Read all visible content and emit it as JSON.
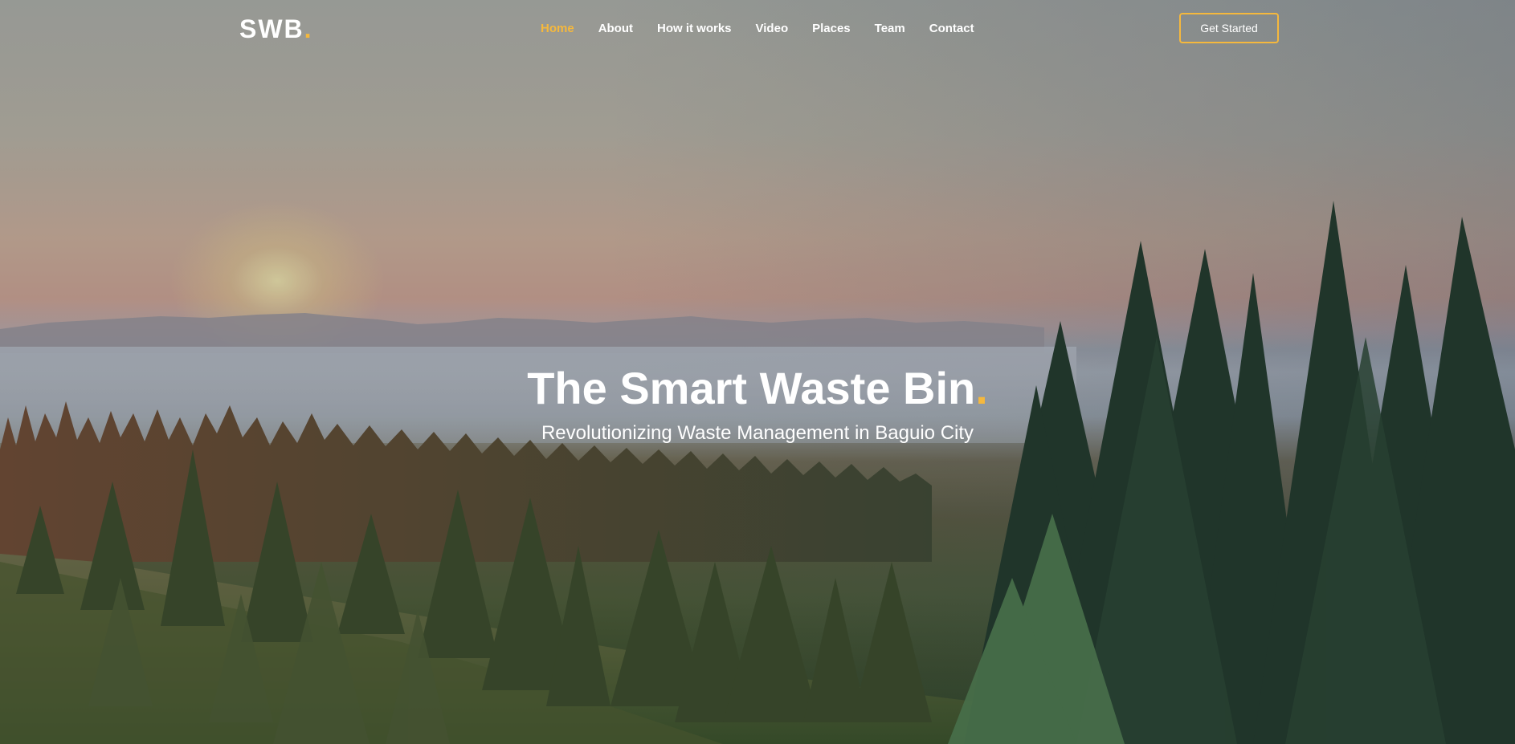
{
  "brand": {
    "name": "SWB",
    "dot": "."
  },
  "nav": {
    "items": [
      {
        "label": "Home",
        "active": true
      },
      {
        "label": "About",
        "active": false
      },
      {
        "label": "How it works",
        "active": false
      },
      {
        "label": "Video",
        "active": false
      },
      {
        "label": "Places",
        "active": false
      },
      {
        "label": "Team",
        "active": false
      },
      {
        "label": "Contact",
        "active": false
      }
    ]
  },
  "header": {
    "cta_label": "Get Started"
  },
  "hero": {
    "title": "The Smart Waste Bin",
    "title_dot": ".",
    "subtitle": "Revolutionizing Waste Management in Baguio City"
  },
  "colors": {
    "accent": "#f5b83d",
    "text": "#ffffff"
  }
}
